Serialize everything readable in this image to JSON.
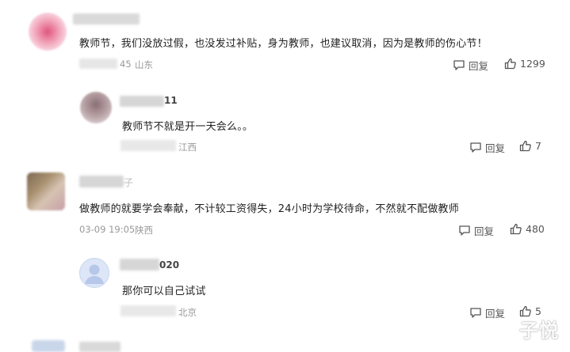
{
  "comments": [
    {
      "text": "教师节，我们没放过假，也没发过补贴，身为教师，也建议取消，因为是教师的伤心节！",
      "meta_time": "45",
      "meta_location": "山东",
      "reply_label": "回复",
      "likes": "1299"
    },
    {
      "name_suffix": "11",
      "text": "教师节不就是开一天会么。。",
      "meta_location": "江西",
      "reply_label": "回复",
      "likes": "7"
    },
    {
      "name_suffix": "子",
      "text": "做教师的就要学会奉献，不计较工资得失，24小时为学校待命，不然就不配做教师",
      "meta_time": "03-09 19:05",
      "meta_location": "陕西",
      "reply_label": "回复",
      "likes": "480"
    },
    {
      "name_suffix": "020",
      "text": "那你可以自己试试",
      "meta_location": "北京",
      "reply_label": "回复",
      "likes": "5"
    }
  ],
  "watermark": "子悦",
  "colors": {
    "meta": "#999999",
    "text": "#222222"
  }
}
